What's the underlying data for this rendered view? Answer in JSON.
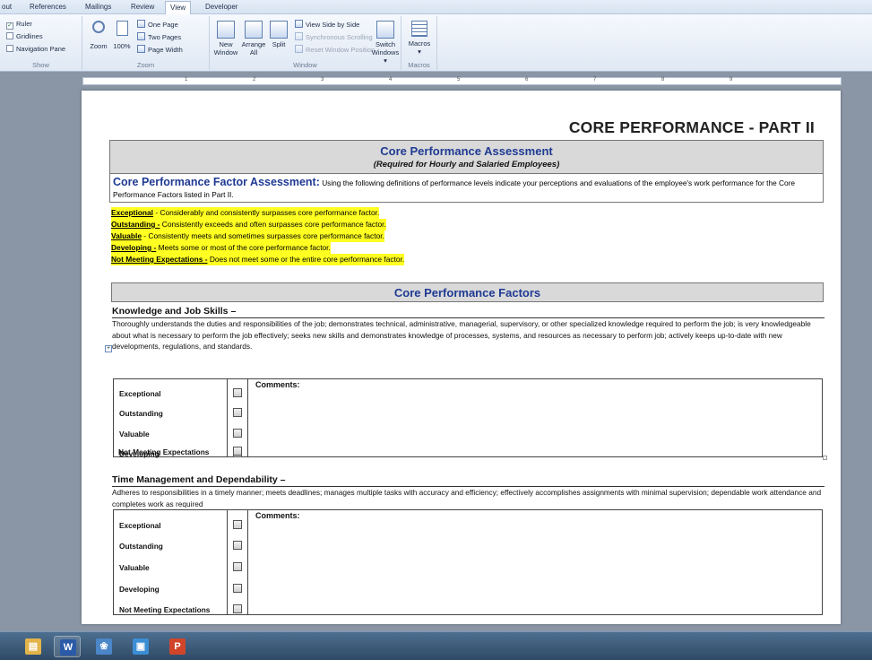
{
  "ribbon": {
    "tabs": [
      {
        "label": "out"
      },
      {
        "label": "References"
      },
      {
        "label": "Mailings"
      },
      {
        "label": "Review"
      },
      {
        "label": "View"
      },
      {
        "label": "Developer"
      }
    ],
    "show": {
      "ruler": "Ruler",
      "gridlines": "Gridlines",
      "navigation_pane": "Navigation Pane",
      "group_label": "Show"
    },
    "zoom": {
      "zoom": "Zoom",
      "hundred": "100%",
      "one_page": "One Page",
      "two_pages": "Two Pages",
      "page_width": "Page Width",
      "group_label": "Zoom"
    },
    "window": {
      "new_window_1": "New",
      "new_window_2": "Window",
      "arrange_all_1": "Arrange",
      "arrange_all_2": "All",
      "split": "Split",
      "side_by_side": "View Side by Side",
      "sync_scrolling": "Synchronous Scrolling",
      "reset_position": "Reset Window Position",
      "switch_1": "Switch",
      "switch_2": "Windows ▾",
      "group_label": "Window"
    },
    "macros": {
      "label": "Macros",
      "arrow": "▾",
      "group_label": "Macros"
    }
  },
  "ruler": {
    "numbers": [
      "1",
      "2",
      "3",
      "4",
      "5",
      "6",
      "7",
      "8",
      "9"
    ]
  },
  "document": {
    "title": "CORE PERFORMANCE - PART II",
    "assessment_title": "Core Performance Assessment",
    "assessment_subtitle": "(Required for Hourly and Salaried Employees)",
    "factor_lead": "Core Performance Factor Assessment:",
    "factor_text": "Using the following definitions of performance levels indicate your perceptions and evaluations of the employee's work performance for the Core Performance Factors listed in Part II.",
    "levels": [
      {
        "name": "Exceptional",
        "desc": " - Considerably and consistently surpasses core performance factor."
      },
      {
        "name": "Outstanding -",
        "desc": " Consistently exceeds and often surpasses core performance factor."
      },
      {
        "name": "Valuable",
        "desc": " - Consistently meets and sometimes surpasses core performance factor."
      },
      {
        "name": "Developing -",
        "desc": " Meets some or most of the core performance factor."
      },
      {
        "name": "Not Meeting Expectations -",
        "desc": " Does not meet some or the entire core performance factor."
      }
    ],
    "factors_title": "Core Performance Factors",
    "sections": [
      {
        "heading": "Knowledge and Job Skills –",
        "description": "Thoroughly understands the duties and responsibilities of the job; demonstrates technical, administrative, managerial, supervisory, or other specialized knowledge required to perform the job; is very knowledgeable about what is necessary to perform the job effectively; seeks new skills and demonstrates knowledge of processes, systems, and resources as necessary to perform job; actively keeps up-to-date with new developments, regulations, and standards.",
        "ratings": [
          "Exceptional",
          "Outstanding",
          "Valuable",
          "Developing",
          "Not Meeting Expectations"
        ],
        "comments_label": "Comments:"
      },
      {
        "heading": "Time Management and Dependability –",
        "description": "Adheres to responsibilities in a timely manner; meets deadlines; manages multiple tasks with accuracy and efficiency; effectively accomplishes assignments with minimal supervision; dependable work attendance and completes work as required",
        "ratings": [
          "Exceptional",
          "Outstanding",
          "Valuable",
          "Developing",
          "Not Meeting Expectations"
        ],
        "comments_label": "Comments:"
      }
    ]
  },
  "taskbar": {
    "items": [
      {
        "icon": "folder-icon",
        "glyph": "▤",
        "color": "#e2b44a"
      },
      {
        "icon": "word-icon",
        "glyph": "W",
        "color": "#2b5aa8"
      },
      {
        "icon": "paint-icon",
        "glyph": "❀",
        "color": "#4a86c8"
      },
      {
        "icon": "explorer-icon",
        "glyph": "▣",
        "color": "#3c8ed4"
      },
      {
        "icon": "powerpoint-icon",
        "glyph": "P",
        "color": "#d0452a"
      }
    ]
  }
}
